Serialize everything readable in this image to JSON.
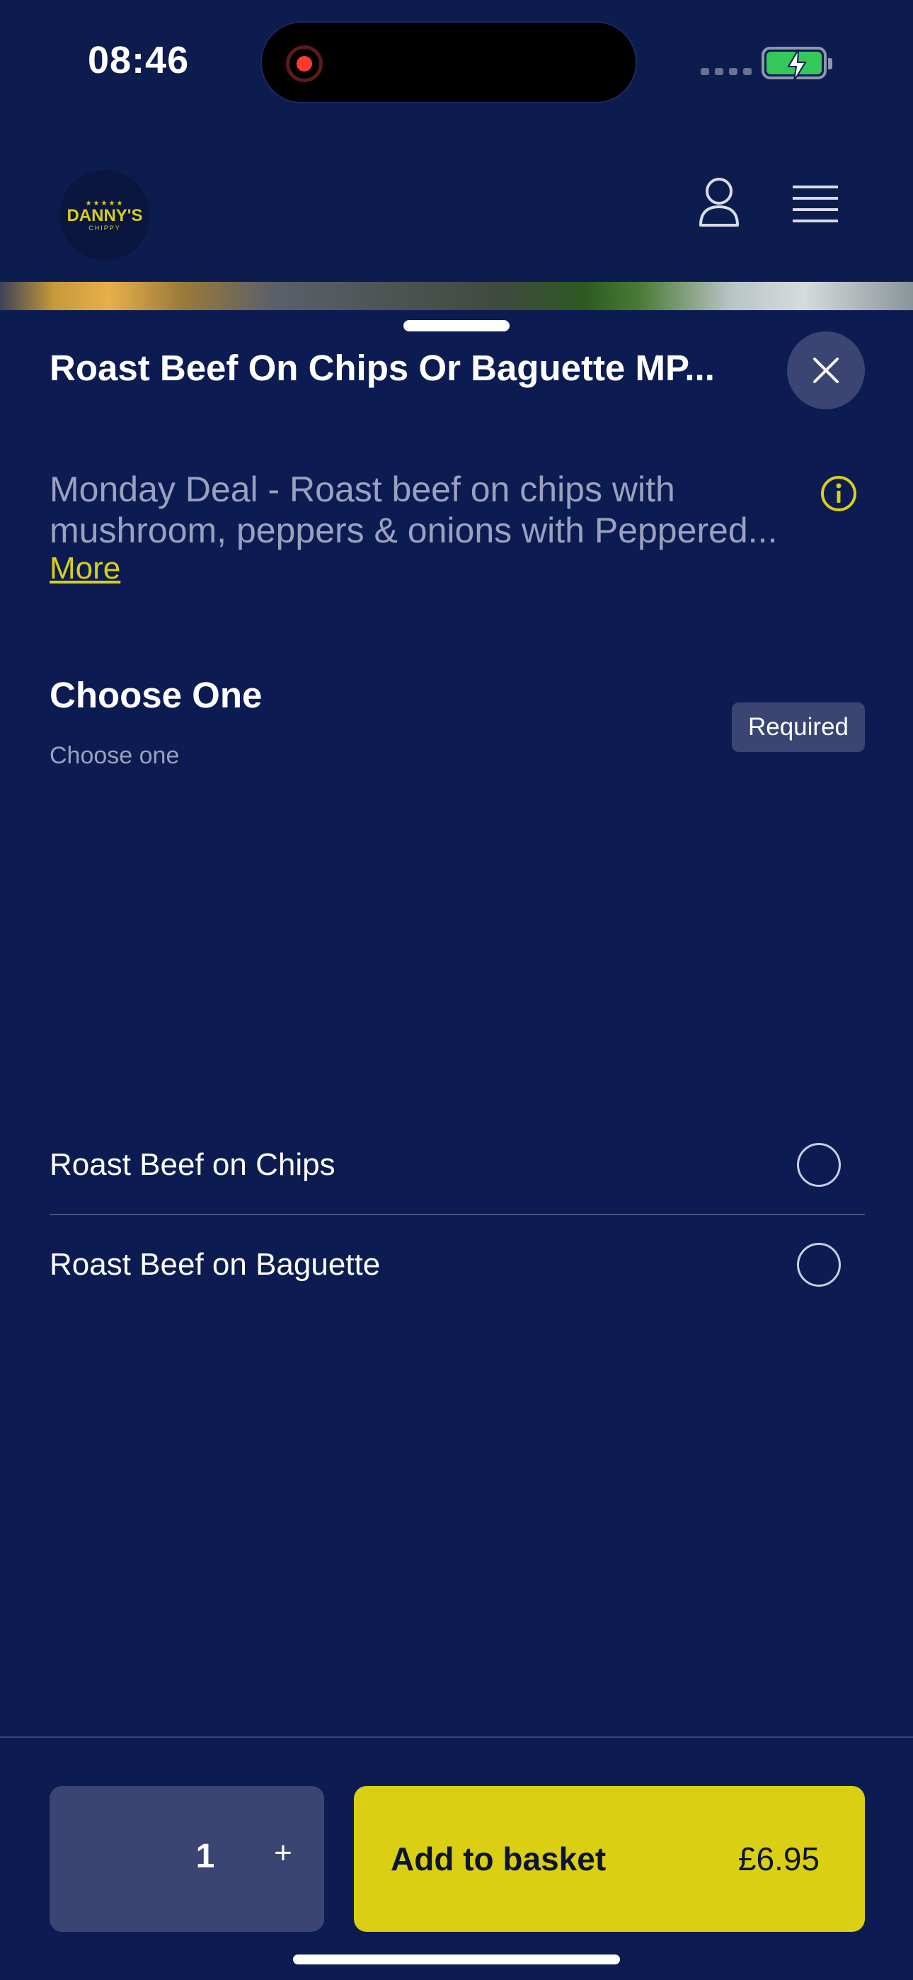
{
  "status_bar": {
    "time": "08:46"
  },
  "header": {
    "logo": {
      "name": "DANNY'S",
      "sub": "CHIPPY",
      "stars": "★★★★★"
    },
    "icons": [
      "user-icon",
      "menu-icon"
    ]
  },
  "sheet": {
    "title": "Roast Beef On Chips Or Baguette MP...",
    "description": "Monday Deal - Roast beef on chips with mushroom, peppers & onions with Peppered...",
    "more_label": "More",
    "group": {
      "title": "Choose One",
      "subtitle": "Choose one",
      "badge": "Required",
      "options": [
        {
          "label": "Roast Beef on Chips",
          "selected": false
        },
        {
          "label": "Roast Beef on Baguette",
          "selected": false
        }
      ]
    }
  },
  "footer": {
    "quantity": "1",
    "plus_label": "+",
    "add_label": "Add to basket",
    "price": "£6.95"
  },
  "colors": {
    "background": "#0c1c52",
    "accent": "#dbcf13",
    "button_muted": "#3a4573"
  }
}
